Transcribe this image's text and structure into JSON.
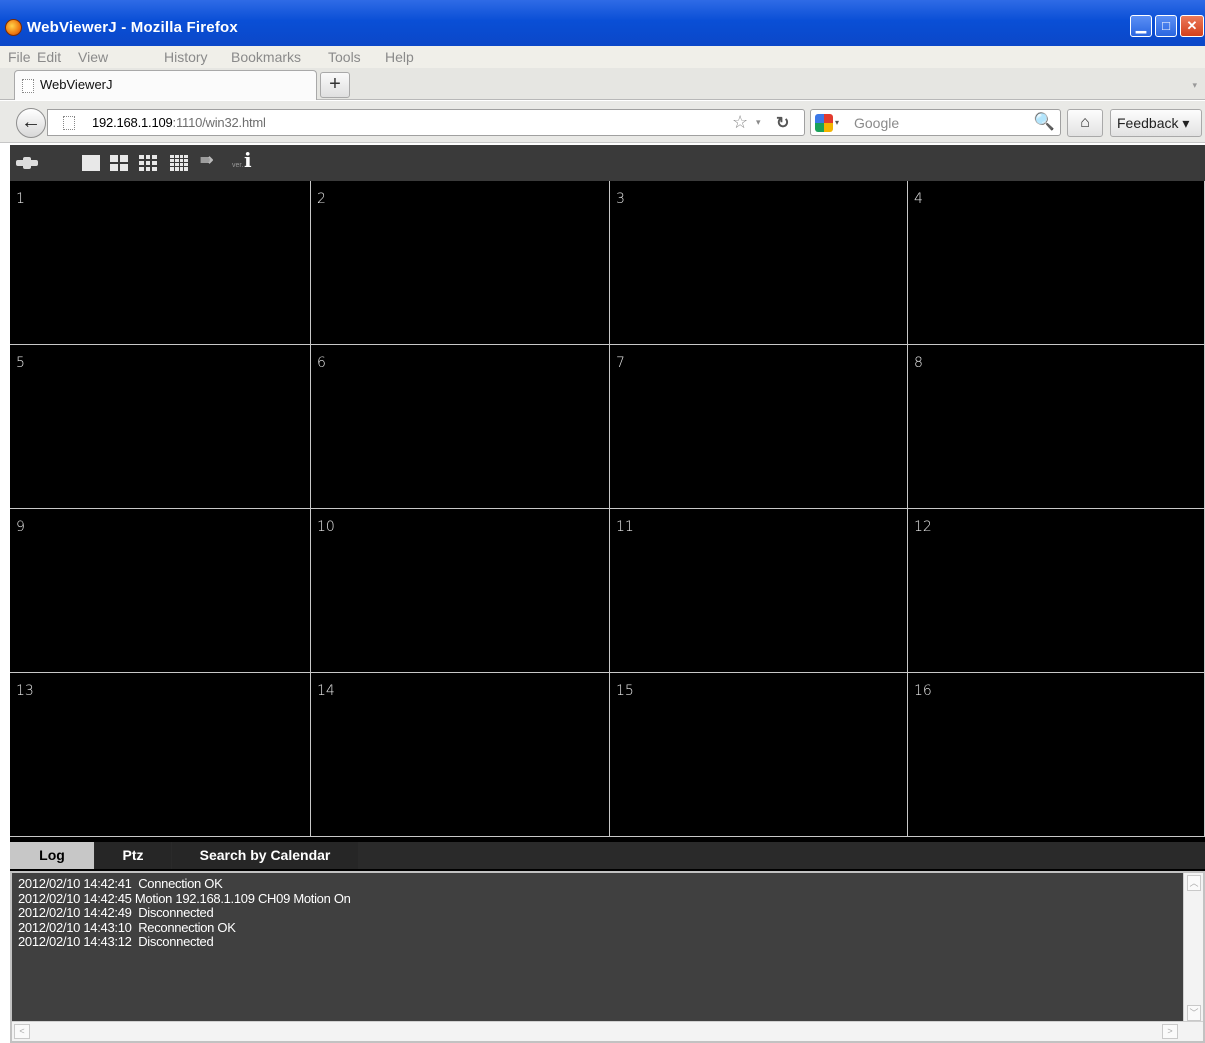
{
  "window": {
    "title": "WebViewerJ - Mozilla Firefox",
    "min_glyph": "▁",
    "max_glyph": "□",
    "close_glyph": "✕"
  },
  "menu": [
    "File",
    "Edit",
    "View",
    "History",
    "Bookmarks",
    "Tools",
    "Help"
  ],
  "tab": {
    "label": "WebViewerJ",
    "new_tab_glyph": "+",
    "list_glyph": "▾"
  },
  "nav": {
    "back_glyph": "←",
    "url_host": "192.168.1.109",
    "url_rest": ":1110/win32.html",
    "star_glyph": "☆",
    "dropdown_glyph": "▾",
    "reload_glyph": "↻",
    "search_engine_dropdown": "▾",
    "search_placeholder": "Google",
    "search_glyph": "🔍",
    "home_glyph": "⌂",
    "feedback_label": "Feedback ▾"
  },
  "toolbar": {
    "sequence_glyph": "⇛",
    "version_label": "ver.",
    "info_glyph": "i",
    "icons": [
      "connect-icon",
      "layout-1-icon",
      "layout-4-icon",
      "layout-9-icon",
      "layout-16-icon",
      "sequence-icon",
      "version-info-icon"
    ]
  },
  "channels": [
    "1",
    "2",
    "3",
    "4",
    "5",
    "6",
    "7",
    "8",
    "9",
    "10",
    "11",
    "12",
    "13",
    "14",
    "15",
    "16"
  ],
  "panel": {
    "tabs": [
      "Log",
      "Ptz",
      "Search by Calendar"
    ],
    "active_tab": "Log",
    "log": [
      "2012/02/10 14:42:41  Connection OK",
      "2012/02/10 14:42:45 Motion 192.168.1.109 CH09 Motion On",
      "2012/02/10 14:42:49  Disconnected",
      "2012/02/10 14:43:10  Reconnection OK",
      "2012/02/10 14:43:12  Disconnected"
    ],
    "scroll_up_glyph": "︿",
    "scroll_down_glyph": "﹀",
    "scroll_left_glyph": "<",
    "scroll_right_glyph": ">"
  },
  "colors": {
    "titlebar": "#0a4fd6",
    "viewer_background": "#000000",
    "toolbar": "#3a3a3a",
    "log_background": "#404040",
    "active_tab": "#c7c7c7"
  }
}
